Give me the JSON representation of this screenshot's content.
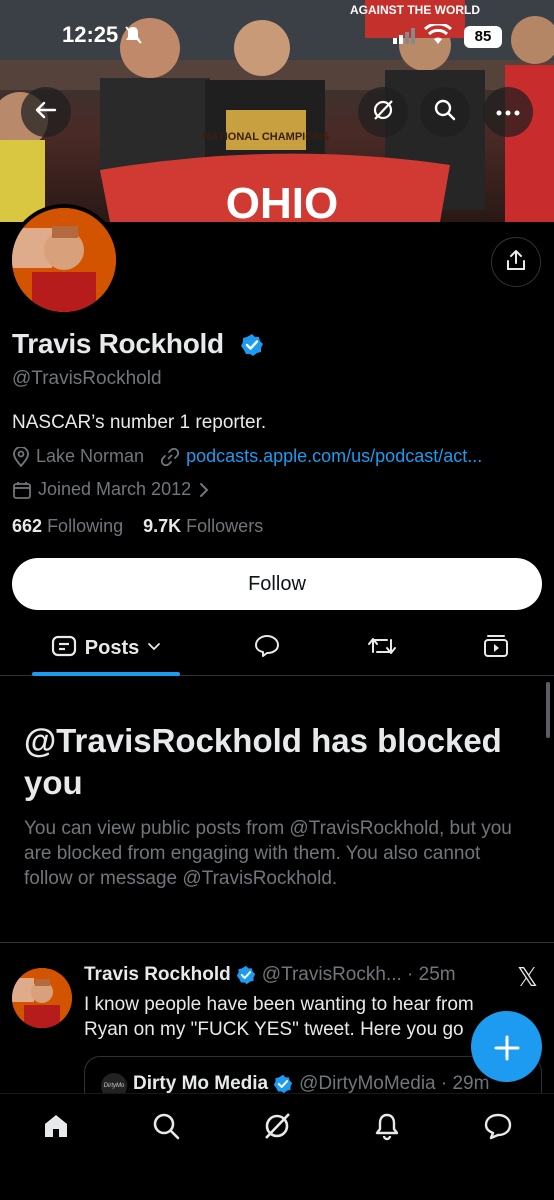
{
  "status_bar": {
    "time": "12:25",
    "battery": "85"
  },
  "banner": {
    "sign_text": "AGAINST THE WORLD",
    "shirt_text": "NATIONAL CHAMPIONS",
    "flag_text": "OHIO"
  },
  "profile": {
    "display_name": "Travis Rockhold",
    "handle": "@TravisRockhold",
    "bio": "NASCAR’s number 1 reporter.",
    "location": "Lake Norman",
    "website": "podcasts.apple.com/us/podcast/act...",
    "joined": "Joined March 2012",
    "following_count": "662",
    "following_label": "Following",
    "followers_count": "9.7K",
    "followers_label": "Followers",
    "follow_button": "Follow"
  },
  "tabs": {
    "posts_label": "Posts"
  },
  "blocked": {
    "title": "@TravisRockhold has blocked you",
    "description": "You can view public posts from @TravisRockhold, but you are blocked from engaging with them. You also cannot follow or message @TravisRockhold."
  },
  "tweet": {
    "name": "Travis Rockhold",
    "handle_time": "@TravisRockh... · 25m",
    "text": "I know people have been wanting to hear from Ryan on my \"FUCK YES\" tweet. Here you go",
    "quote": {
      "name": "Dirty Mo Media",
      "handle_time": "@DirtyMoMedia · 29m",
      "avatar_text": "DirtyMo"
    }
  },
  "colors": {
    "accent": "#1d9bf0",
    "background": "#000000",
    "muted": "#71767b"
  },
  "icons": {
    "back": "arrow-left-icon",
    "grok": "grok-icon",
    "search": "search-icon",
    "more": "more-icon",
    "share": "share-icon",
    "location": "location-icon",
    "link": "link-icon",
    "calendar": "calendar-icon",
    "home": "home-icon",
    "notifications": "bell-icon",
    "messages": "message-icon",
    "compose": "plus-icon"
  }
}
